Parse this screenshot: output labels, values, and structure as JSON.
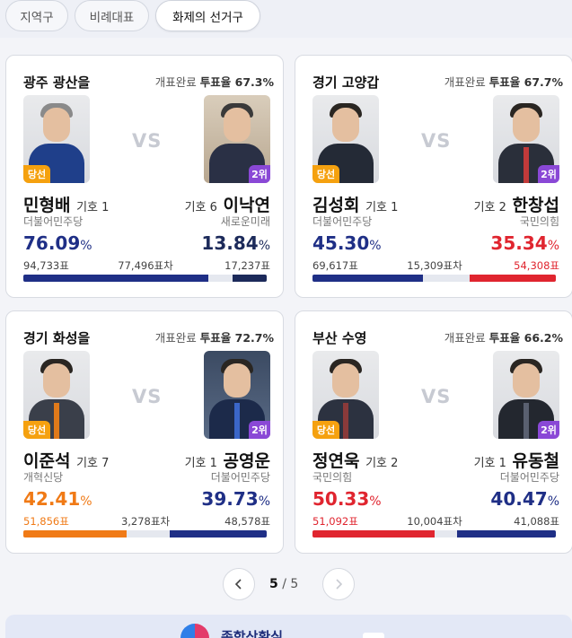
{
  "tabs": [
    {
      "label": "지역구"
    },
    {
      "label": "비례대표"
    },
    {
      "label": "화제의 선거구",
      "active": true
    }
  ],
  "cards": [
    {
      "region": "광주 광산을",
      "status": "개표완료",
      "turnout": "투표율 67.3%",
      "vs": "VS",
      "left": {
        "name": "민형배",
        "num": "기호 1",
        "party": "더불어민주당",
        "pct": "76.09",
        "pct_unit": "%",
        "votes": "94,733표",
        "badge": "당선"
      },
      "right": {
        "name": "이낙연",
        "num": "기호 6",
        "party": "새로운미래",
        "pct": "13.84",
        "pct_unit": "%",
        "votes": "17,237표",
        "badge": "2위"
      },
      "diff": "77,496표차",
      "bar": {
        "left_share": 0.7609,
        "right_share": 0.1384,
        "left_color": "#1f2f86",
        "right_color": "#1c2a5a"
      }
    },
    {
      "region": "경기 고양갑",
      "status": "개표완료",
      "turnout": "투표율 67.7%",
      "vs": "VS",
      "left": {
        "name": "김성회",
        "num": "기호 1",
        "party": "더불어민주당",
        "pct": "45.30",
        "pct_unit": "%",
        "votes": "69,617표",
        "badge": "당선"
      },
      "right": {
        "name": "한창섭",
        "num": "기호 2",
        "party": "국민의힘",
        "pct": "35.34",
        "pct_unit": "%",
        "votes": "54,308표",
        "badge": "2위"
      },
      "diff": "15,309표차",
      "bar": {
        "left_share": 0.453,
        "right_share": 0.3534,
        "left_color": "#1f2f86",
        "right_color": "#e0252f"
      }
    },
    {
      "region": "경기 화성을",
      "status": "개표완료",
      "turnout": "투표율 72.7%",
      "vs": "VS",
      "left": {
        "name": "이준석",
        "num": "기호 7",
        "party": "개혁신당",
        "pct": "42.41",
        "pct_unit": "%",
        "votes": "51,856표",
        "badge": "당선"
      },
      "right": {
        "name": "공영운",
        "num": "기호 1",
        "party": "더불어민주당",
        "pct": "39.73",
        "pct_unit": "%",
        "votes": "48,578표",
        "badge": "2위"
      },
      "diff": "3,278표차",
      "bar": {
        "left_share": 0.4241,
        "right_share": 0.3973,
        "left_color": "#f07a16",
        "right_color": "#1f2f86"
      }
    },
    {
      "region": "부산 수영",
      "status": "개표완료",
      "turnout": "투표율 66.2%",
      "vs": "VS",
      "left": {
        "name": "정연욱",
        "num": "기호 2",
        "party": "국민의힘",
        "pct": "50.33",
        "pct_unit": "%",
        "votes": "51,092표",
        "badge": "당선"
      },
      "right": {
        "name": "유동철",
        "num": "기호 1",
        "party": "더불어민주당",
        "pct": "40.47",
        "pct_unit": "%",
        "votes": "41,088표",
        "badge": "2위"
      },
      "diff": "10,004표차",
      "bar": {
        "left_share": 0.5033,
        "right_share": 0.4047,
        "left_color": "#e0252f",
        "right_color": "#1f2f86"
      }
    }
  ],
  "pager": {
    "current": "5",
    "separator": "/",
    "total": "5",
    "prev_icon": "chevron-left-icon",
    "next_icon": "chevron-right-icon"
  },
  "banner": {
    "text": "종합상황실"
  }
}
